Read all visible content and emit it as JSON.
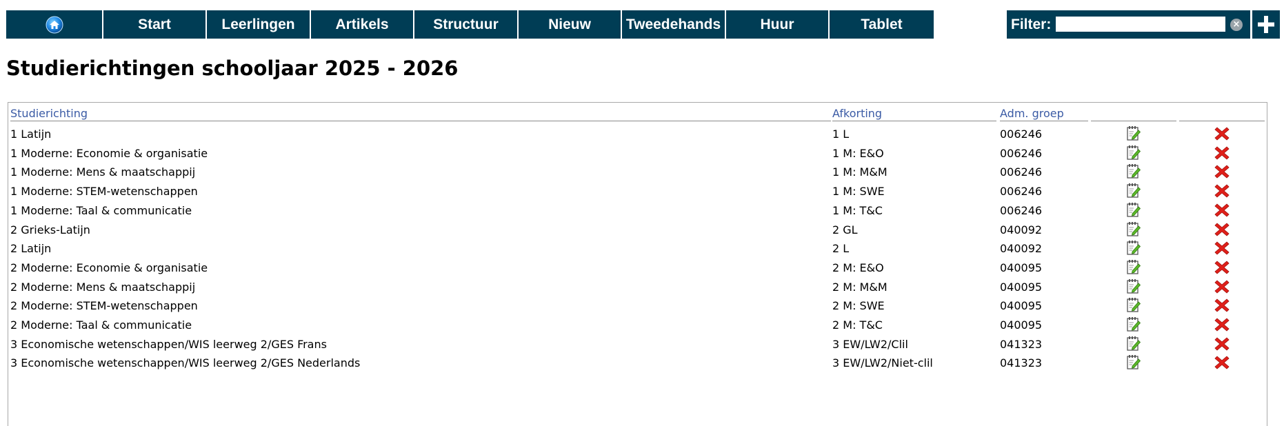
{
  "nav": {
    "home_icon": "home-icon",
    "items": [
      "Start",
      "Leerlingen",
      "Artikels",
      "Structuur",
      "Nieuw",
      "Tweedehands",
      "Huur",
      "Tablet"
    ]
  },
  "filter": {
    "label": "Filter:",
    "value": "",
    "placeholder": "",
    "clear_icon": "clear-icon"
  },
  "add_button": {
    "icon": "plus-icon"
  },
  "title": "Studierichtingen schooljaar 2025 - 2026",
  "table": {
    "columns": [
      "Studierichting",
      "Afkorting",
      "Adm. groep",
      "",
      ""
    ],
    "rows": [
      {
        "name": "1 Latijn",
        "abbr": "1 L",
        "group": "006246"
      },
      {
        "name": "1 Moderne: Economie & organisatie",
        "abbr": "1 M: E&O",
        "group": "006246"
      },
      {
        "name": "1 Moderne: Mens & maatschappij",
        "abbr": "1 M: M&M",
        "group": "006246"
      },
      {
        "name": "1 Moderne: STEM-wetenschappen",
        "abbr": "1 M: SWE",
        "group": "006246"
      },
      {
        "name": "1 Moderne: Taal & communicatie",
        "abbr": "1 M: T&C",
        "group": "006246"
      },
      {
        "name": "2 Grieks-Latijn",
        "abbr": "2 GL",
        "group": "040092"
      },
      {
        "name": "2 Latijn",
        "abbr": "2 L",
        "group": "040092"
      },
      {
        "name": "2 Moderne: Economie & organisatie",
        "abbr": "2 M: E&O",
        "group": "040095"
      },
      {
        "name": "2 Moderne: Mens & maatschappij",
        "abbr": "2 M: M&M",
        "group": "040095"
      },
      {
        "name": "2 Moderne: STEM-wetenschappen",
        "abbr": "2 M: SWE",
        "group": "040095"
      },
      {
        "name": "2 Moderne: Taal & communicatie",
        "abbr": "2 M: T&C",
        "group": "040095"
      },
      {
        "name": "3 Economische wetenschappen/WIS leerweg 2/GES Frans",
        "abbr": "3 EW/LW2/Clil",
        "group": "041323"
      },
      {
        "name": "3 Economische wetenschappen/WIS leerweg 2/GES Nederlands",
        "abbr": "3 EW/LW2/Niet-clil",
        "group": "041323"
      }
    ],
    "row_icons": {
      "edit": "edit-icon",
      "delete": "delete-icon"
    }
  },
  "colors": {
    "nav_bg": "#003d55",
    "header_link": "#3b5ba5",
    "delete_red": "#e0201a"
  }
}
